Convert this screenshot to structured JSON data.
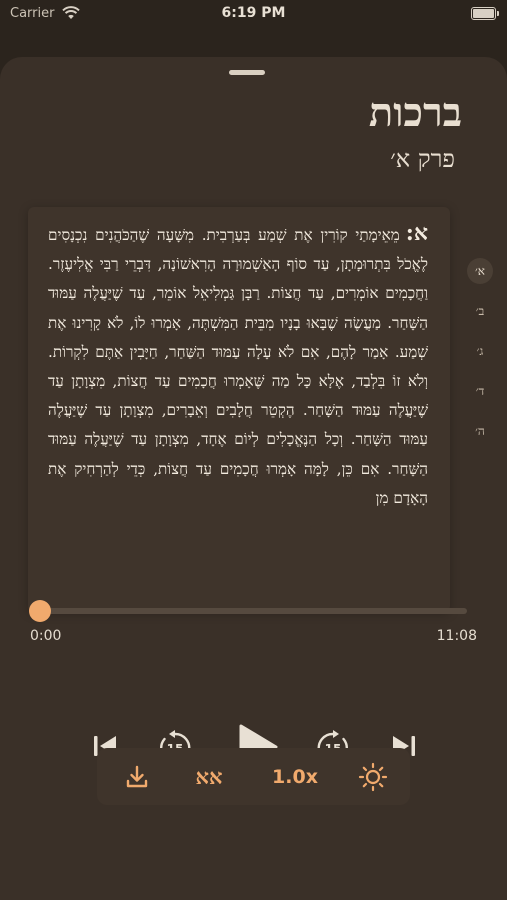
{
  "status_bar": {
    "carrier": "Carrier",
    "time": "6:19 PM"
  },
  "header": {
    "title": "ברכות",
    "subtitle": "פרק א׳"
  },
  "text": {
    "marker": "א:",
    "body": "מֵאֵימָתַי קוֹרִין אֶת שְׁמַע בְּעַרְבִית. מִשָּׁעָה שֶׁהַכֹּהֲנִים נִכְנָסִים לֶאֱכֹל בִּתְרוּמָתָן, עַד סוֹף הָאַשְׁמוּרָה הָרִאשׁוֹנָה, דִּבְרֵי רַבִּי אֱלִיעֶזֶר. וַחֲכָמִים אוֹמְרִים, עַד חֲצוֹת. רַבָּן גַּמְלִיאֵל אוֹמֵר, עַד שֶׁיַּעֲלֶה עַמּוּד הַשָּׁחַר. מַעֲשֶׂה שֶׁבָּאוּ בָנָיו מִבֵּית הַמִּשְׁתֶּה, אָמְרוּ לוֹ, לֹא קָרִינוּ אֶת שְׁמַע. אָמַר לָהֶם, אִם לֹא עָלָה עַמּוּד הַשַּׁחַר, חַיָּבִין אַתֶּם לִקְרוֹת. וְלֹא זוֹ בִּלְבַד, אֶלָּא כָּל מַה שֶּׁאָמְרוּ חֲכָמִים עַד חֲצוֹת, מִצְוָתָן עַד שֶׁיַּעֲלֶה עַמּוּד הַשָּׁחַר. הֶקְטֵר חֲלָבִים וְאֵבָרִים, מִצְוָתָן עַד שֶׁיַּעֲלֶה עַמּוּד הַשָּׁחַר. וְכָל הַנֶּאֱכָלִים לְיוֹם אֶחָד, מִצְוָתָן עַד שֶׁיַּעֲלֶה עַמּוּד הַשָּׁחַר. אִם כֵּן, לָמָּה אָמְרוּ חֲכָמִים עַד חֲצוֹת, כְּדֵי לְהַרְחִיק אֶת הָאָדָם מִן"
  },
  "index": [
    "א׳",
    "ב׳",
    "ג׳",
    "ד׳",
    "ה׳"
  ],
  "player": {
    "elapsed": "0:00",
    "total": "11:08",
    "progress": 0,
    "skip_seconds": "15"
  },
  "toolbar": {
    "font_label": "אא",
    "speed": "1.0x"
  },
  "colors": {
    "accent": "#f1aa6d",
    "background": "#2b241d",
    "sheet": "#3a3028",
    "card": "#3f342b"
  },
  "icons": [
    "wifi-icon",
    "battery-icon",
    "skip-to-start-icon",
    "rewind-15-icon",
    "play-icon",
    "forward-15-icon",
    "skip-to-end-icon",
    "download-icon",
    "brightness-icon"
  ]
}
